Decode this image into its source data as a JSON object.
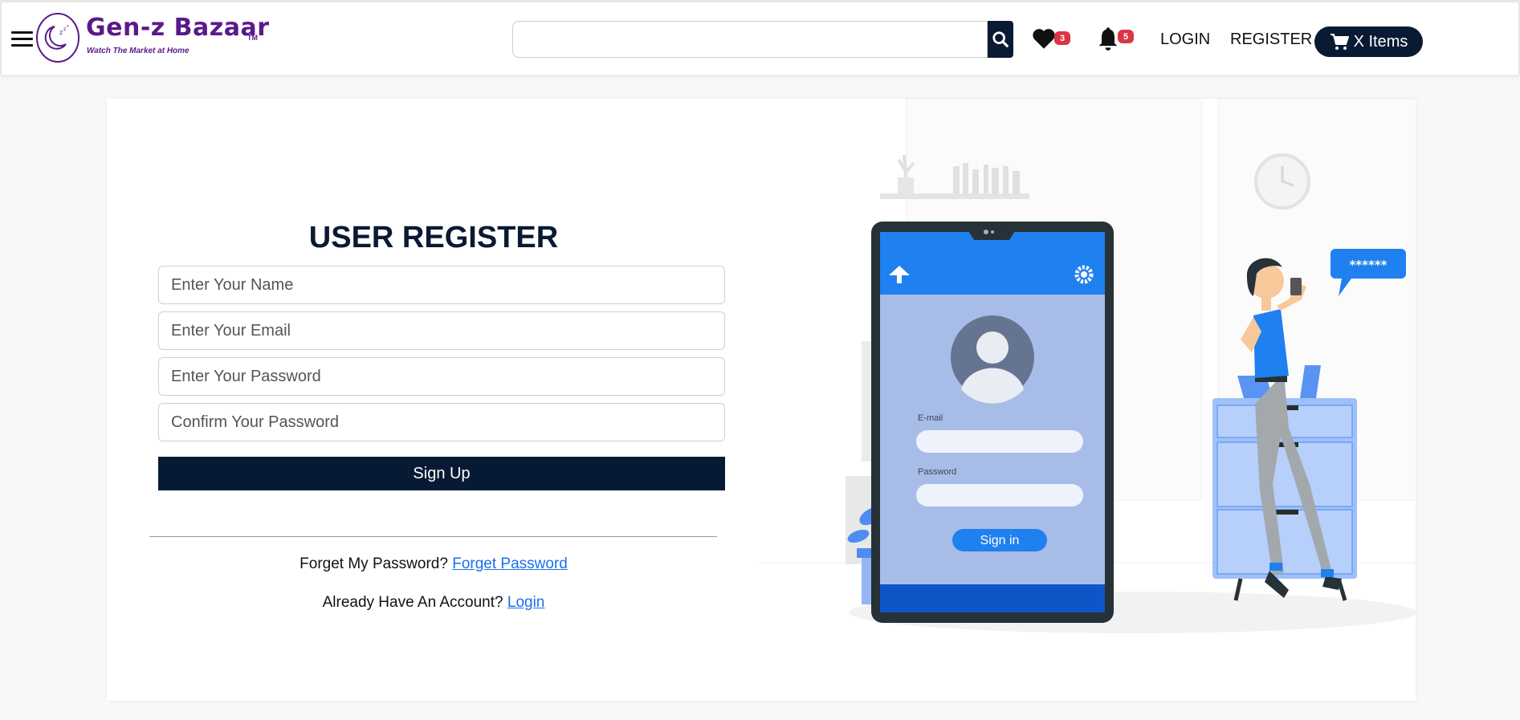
{
  "header": {
    "brand_name": "Gen-z Bazaar",
    "brand_tm": "TM",
    "tagline": "Watch The Market at Home",
    "search_placeholder": "",
    "wishlist_count": "3",
    "notification_count": "5",
    "login_label": "LOGIN",
    "register_label": "REGISTER",
    "cart_label": "X Items",
    "colors": {
      "brand": "#5a1a8a",
      "dark": "#0b1a33",
      "badge": "#dc3545"
    },
    "icons": [
      "menu-icon",
      "moon-logo-icon",
      "search-icon",
      "heart-icon",
      "bell-icon",
      "cart-icon"
    ]
  },
  "form": {
    "title": "USER REGISTER",
    "name_placeholder": "Enter Your Name",
    "email_placeholder": "Enter Your Email",
    "password_placeholder": "Enter Your Password",
    "confirm_placeholder": "Confirm Your Password",
    "signup_label": "Sign Up",
    "forgot_text": "Forget My Password?",
    "forgot_link": "Forget Password",
    "account_text": "Already Have An Account?",
    "login_link": "Login"
  },
  "illustration": {
    "email_label": "E-mail",
    "password_label": "Password",
    "signin_label": "Sign in",
    "bubble_text": "******"
  }
}
